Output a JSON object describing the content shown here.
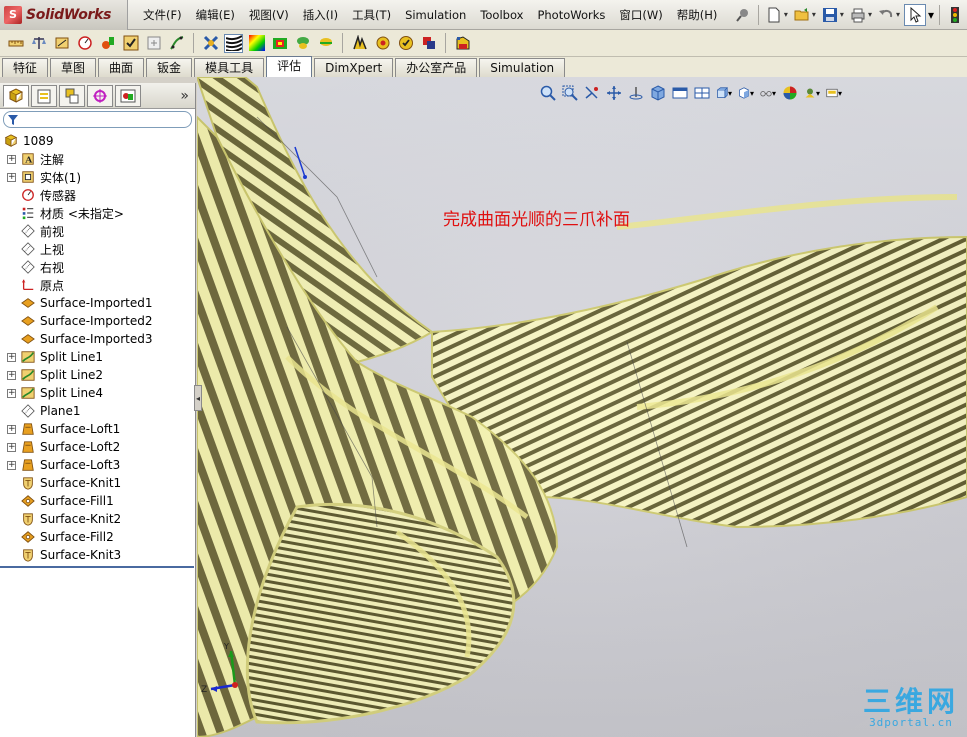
{
  "app": {
    "logo_text": "SolidWorks"
  },
  "menu": [
    "文件(F)",
    "编辑(E)",
    "视图(V)",
    "插入(I)",
    "工具(T)",
    "Simulation",
    "Toolbox",
    "PhotoWorks",
    "窗口(W)",
    "帮助(H)"
  ],
  "cm_tabs": [
    "特征",
    "草图",
    "曲面",
    "钣金",
    "模具工具",
    "评估",
    "DimXpert",
    "办公室产品",
    "Simulation"
  ],
  "active_tab": "评估",
  "tree": {
    "root": "1089",
    "items": [
      {
        "label": "注解",
        "expandable": true,
        "icon": "annotation-icon"
      },
      {
        "label": "实体(1)",
        "expandable": true,
        "icon": "solid-bodies-icon"
      },
      {
        "label": "传感器",
        "expandable": false,
        "icon": "sensor-icon"
      },
      {
        "label": "材质 <未指定>",
        "expandable": false,
        "icon": "material-icon"
      },
      {
        "label": "前视",
        "expandable": false,
        "icon": "plane-icon"
      },
      {
        "label": "上视",
        "expandable": false,
        "icon": "plane-icon"
      },
      {
        "label": "右视",
        "expandable": false,
        "icon": "plane-icon"
      },
      {
        "label": "原点",
        "expandable": false,
        "icon": "origin-icon"
      },
      {
        "label": "Surface-Imported1",
        "expandable": false,
        "icon": "surface-imported-icon"
      },
      {
        "label": "Surface-Imported2",
        "expandable": false,
        "icon": "surface-imported-icon"
      },
      {
        "label": "Surface-Imported3",
        "expandable": false,
        "icon": "surface-imported-icon"
      },
      {
        "label": "Split Line1",
        "expandable": true,
        "icon": "split-line-icon"
      },
      {
        "label": "Split Line2",
        "expandable": true,
        "icon": "split-line-icon"
      },
      {
        "label": "Split Line4",
        "expandable": true,
        "icon": "split-line-icon"
      },
      {
        "label": "Plane1",
        "expandable": false,
        "icon": "plane-icon"
      },
      {
        "label": "Surface-Loft1",
        "expandable": true,
        "icon": "surface-loft-icon"
      },
      {
        "label": "Surface-Loft2",
        "expandable": true,
        "icon": "surface-loft-icon"
      },
      {
        "label": "Surface-Loft3",
        "expandable": true,
        "icon": "surface-loft-icon"
      },
      {
        "label": "Surface-Knit1",
        "expandable": false,
        "icon": "surface-knit-icon"
      },
      {
        "label": "Surface-Fill1",
        "expandable": false,
        "icon": "surface-fill-icon"
      },
      {
        "label": "Surface-Knit2",
        "expandable": false,
        "icon": "surface-knit-icon"
      },
      {
        "label": "Surface-Fill2",
        "expandable": false,
        "icon": "surface-fill-icon"
      },
      {
        "label": "Surface-Knit3",
        "expandable": false,
        "icon": "surface-knit-icon"
      }
    ]
  },
  "viewport": {
    "annotation": "完成曲面光顺的三爪补面",
    "triad_z": "Z",
    "triad_y": "Y"
  },
  "watermark": {
    "main": "三维网",
    "sub": "3dportal.cn"
  },
  "colors": {
    "zebra_light": "#f6f4b8",
    "zebra_dark": "#6e6a3c",
    "annotation": "#e01010",
    "watermark": "#3aa8e0"
  }
}
